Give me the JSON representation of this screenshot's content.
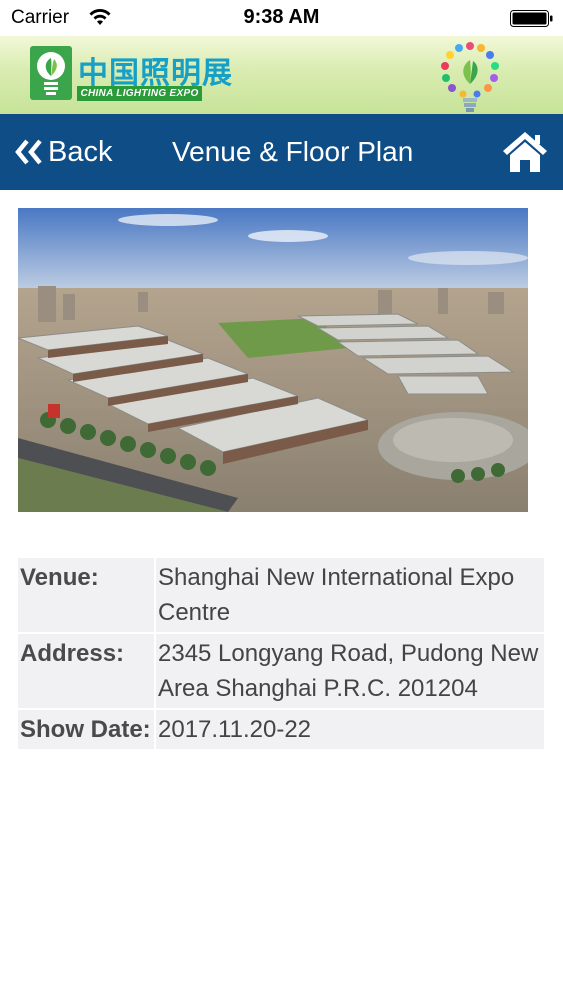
{
  "status_bar": {
    "carrier": "Carrier",
    "time": "9:38 AM"
  },
  "banner": {
    "logo_cn": "中国照明展",
    "logo_en": "CHINA LIGHTING EXPO"
  },
  "nav": {
    "back_label": "Back",
    "title": "Venue & Floor Plan"
  },
  "info": {
    "venue_label": "Venue:",
    "venue_value": "Shanghai New International Expo Centre",
    "address_label": "Address:",
    "address_value": "2345 Longyang Road, Pudong New Area Shanghai P.R.C. 201204",
    "show_date_label": "Show Date:",
    "show_date_value": "2017.11.20-22"
  },
  "icons": {
    "back": "double-chevron-left-icon",
    "home": "home-icon",
    "wifi": "wifi-icon",
    "battery": "battery-icon"
  },
  "colors": {
    "navbar": "#0e4d86",
    "banner_green": "#c6e398",
    "logo_blue": "#17a0c7",
    "table_bg": "#f1f0f2"
  }
}
